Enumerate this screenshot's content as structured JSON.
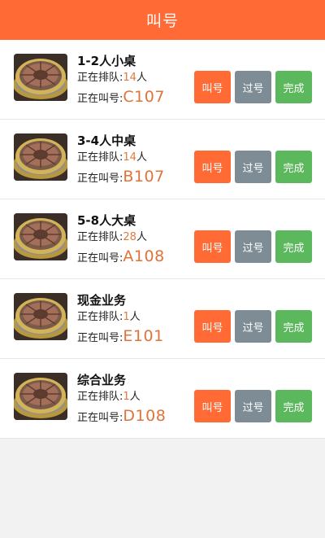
{
  "header": {
    "title": "叫号"
  },
  "labels": {
    "queue_prefix": "正在排队:",
    "queue_suffix": "人",
    "calling_prefix": "正在叫号:"
  },
  "buttons": {
    "call": "叫号",
    "skip": "过号",
    "done": "完成"
  },
  "rows": [
    {
      "name": "1-2人小桌",
      "queue": "14",
      "calling": "C107"
    },
    {
      "name": "3-4人中桌",
      "queue": "14",
      "calling": "B107"
    },
    {
      "name": "5-8人大桌",
      "queue": "28",
      "calling": "A108"
    },
    {
      "name": "现金业务",
      "queue": "1",
      "calling": "E101"
    },
    {
      "name": "综合业务",
      "queue": "1",
      "calling": "D108"
    }
  ],
  "colors": {
    "accent": "#ff6a35",
    "skip": "#7d8c95",
    "done": "#5cb85c",
    "number": "#e0733a"
  },
  "icons": {
    "thumbnail": "grill-plate-image"
  }
}
